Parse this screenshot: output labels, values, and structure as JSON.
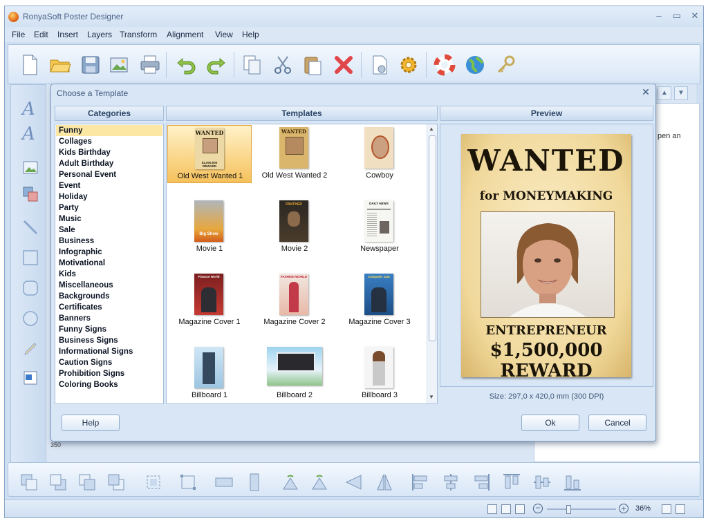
{
  "window": {
    "title": "RonyaSoft Poster Designer"
  },
  "menu": [
    "File",
    "Edit",
    "Insert",
    "Layers",
    "Transform",
    "Alignment",
    "View",
    "Help"
  ],
  "toolbar_icons": [
    "new-file-icon",
    "open-folder-icon",
    "save-icon",
    "save-as-image-icon",
    "print-icon",
    "undo-icon",
    "redo-icon",
    "copy-icon",
    "cut-icon",
    "paste-icon",
    "delete-icon",
    "page-setup-icon",
    "settings-gear-icon",
    "help-lifebuoy-icon",
    "web-globe-icon",
    "register-key-icon"
  ],
  "dialog": {
    "title": "Choose a Template",
    "headers": {
      "categories": "Categories",
      "templates": "Templates",
      "preview": "Preview"
    },
    "categories": [
      "Funny",
      "Collages",
      "Kids Birthday",
      "Adult Birthday",
      "Personal Event",
      "Event",
      "Holiday",
      "Party",
      "Music",
      "Sale",
      "Business",
      "Infographic",
      "Motivational",
      "Kids",
      "Miscellaneous",
      "Backgrounds",
      "Certificates",
      "Banners",
      "Funny Signs",
      "Business Signs",
      "Informational Signs",
      "Caution Signs",
      "Prohibition Signs",
      "Coloring Books"
    ],
    "selected_category": "Funny",
    "templates": [
      {
        "label": "Old West Wanted 1",
        "selected": true
      },
      {
        "label": "Old West Wanted 2"
      },
      {
        "label": "Cowboy"
      },
      {
        "label": "Movie 1"
      },
      {
        "label": "Movie 2"
      },
      {
        "label": "Newspaper"
      },
      {
        "label": "Magazine Cover 1"
      },
      {
        "label": "Magazine Cover 2"
      },
      {
        "label": "Magazine Cover 3"
      },
      {
        "label": "Billboard 1"
      },
      {
        "label": "Billboard 2"
      },
      {
        "label": "Billboard 3"
      }
    ],
    "thumb_texts": {
      "wanted": "WANTED",
      "wanted_reward": "$1,000,000 REWARD",
      "wanted2": "WANTED",
      "movie_footer": "Big Show",
      "movie2_header": "PANTHER",
      "newspaper_header": "DAILY NEWS",
      "mag1_header": "Finance World",
      "mag2_header": "FASHION WORLD",
      "mag3_header": "Computer Jam"
    },
    "preview_poster": {
      "line1": "WANTED",
      "line2": "for MONEYMAKING",
      "line3": "ENTREPRENEUR",
      "line4": "$1,500,000 REWARD"
    },
    "size_text": "Size: 297,0 x 420,0 mm (300 DPI)",
    "buttons": {
      "help": "Help",
      "ok": "Ok",
      "cancel": "Cancel"
    }
  },
  "background": {
    "right_pane_text": "pen an",
    "ruler_text": "350"
  },
  "status": {
    "zoom": "36%"
  }
}
